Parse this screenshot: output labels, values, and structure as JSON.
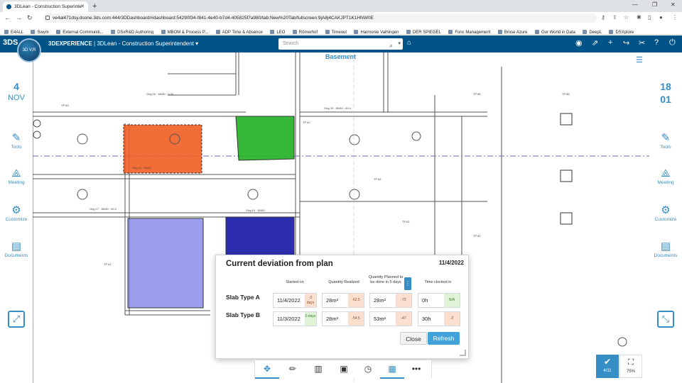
{
  "browser": {
    "tab_title": "3DLean - Construction Superinte",
    "url": "ve4al471dsy.dsone.3ds.com:444/3DDashboard/#dashboard:54290f34-f841-4e40-b7d4-405825f7a980/tab:New%20Tab/fullscreen:9jA8j4CAKJPT1K1HNW0E",
    "bookmarks": [
      "E4ALL",
      "Swym",
      "External Communiti...",
      "DSxR&D Authoring",
      "MBOM & Process P...",
      "ADP Time & Absence",
      "LEO",
      "Römerhof",
      "Timeout",
      "Harmonie Vaihingen",
      "DER SPIEGEL",
      "Func Management",
      "Brose Azure",
      "Our World in Data",
      "DeepL",
      "DSXplore"
    ]
  },
  "header": {
    "brand_prefix": "3DEXPERIENCE",
    "brand_app": "| 3DLean - Construction Superintendent",
    "search_placeholder": "Search",
    "compass_label": "3D V,R"
  },
  "left_panel": {
    "day": "4",
    "month": "NOV",
    "items": [
      {
        "label": "Tools",
        "icon": "tools-icon"
      },
      {
        "label": "Meeting",
        "icon": "meeting-icon"
      },
      {
        "label": "Customize",
        "icon": "gear-icon"
      },
      {
        "label": "Documents",
        "icon": "document-icon"
      }
    ]
  },
  "right_panel": {
    "day": "18",
    "month": "01",
    "items": [
      {
        "label": "Tools",
        "icon": "tools-icon"
      },
      {
        "label": "Meeting",
        "icon": "meeting-icon"
      },
      {
        "label": "Customize",
        "icon": "gear-icon"
      },
      {
        "label": "Documents",
        "icon": "document-icon"
      }
    ]
  },
  "drawing": {
    "label_basement": "Basement"
  },
  "deviation": {
    "title": "Current deviation from plan",
    "date": "11/4/2022",
    "columns": {
      "started_on": "Started on",
      "quantity_realized": "Quantity Realized",
      "quantity_planned": "Quantity Planned to be done in 5 days",
      "time_clocked": "Time clocked in"
    },
    "rows": [
      {
        "label": "Slab Type A",
        "started": "11/4/2022",
        "started_tag": "-3 days",
        "realized": "28m²",
        "realized_tag": "-62.5",
        "planned": "28m²",
        "planned_tag": "-72",
        "time": "0h",
        "time_tag": "N/A"
      },
      {
        "label": "Slab Type B",
        "started": "11/3/2022",
        "started_tag": "0 days",
        "realized": "28m²",
        "realized_tag": "-54.5",
        "planned": "53m²",
        "planned_tag": "-47",
        "time": "30h",
        "time_tag": "-2"
      }
    ],
    "close_label": "Close",
    "refresh_label": "Refresh"
  },
  "widgets": {
    "tasks": "4/11",
    "zoom": "75%"
  }
}
